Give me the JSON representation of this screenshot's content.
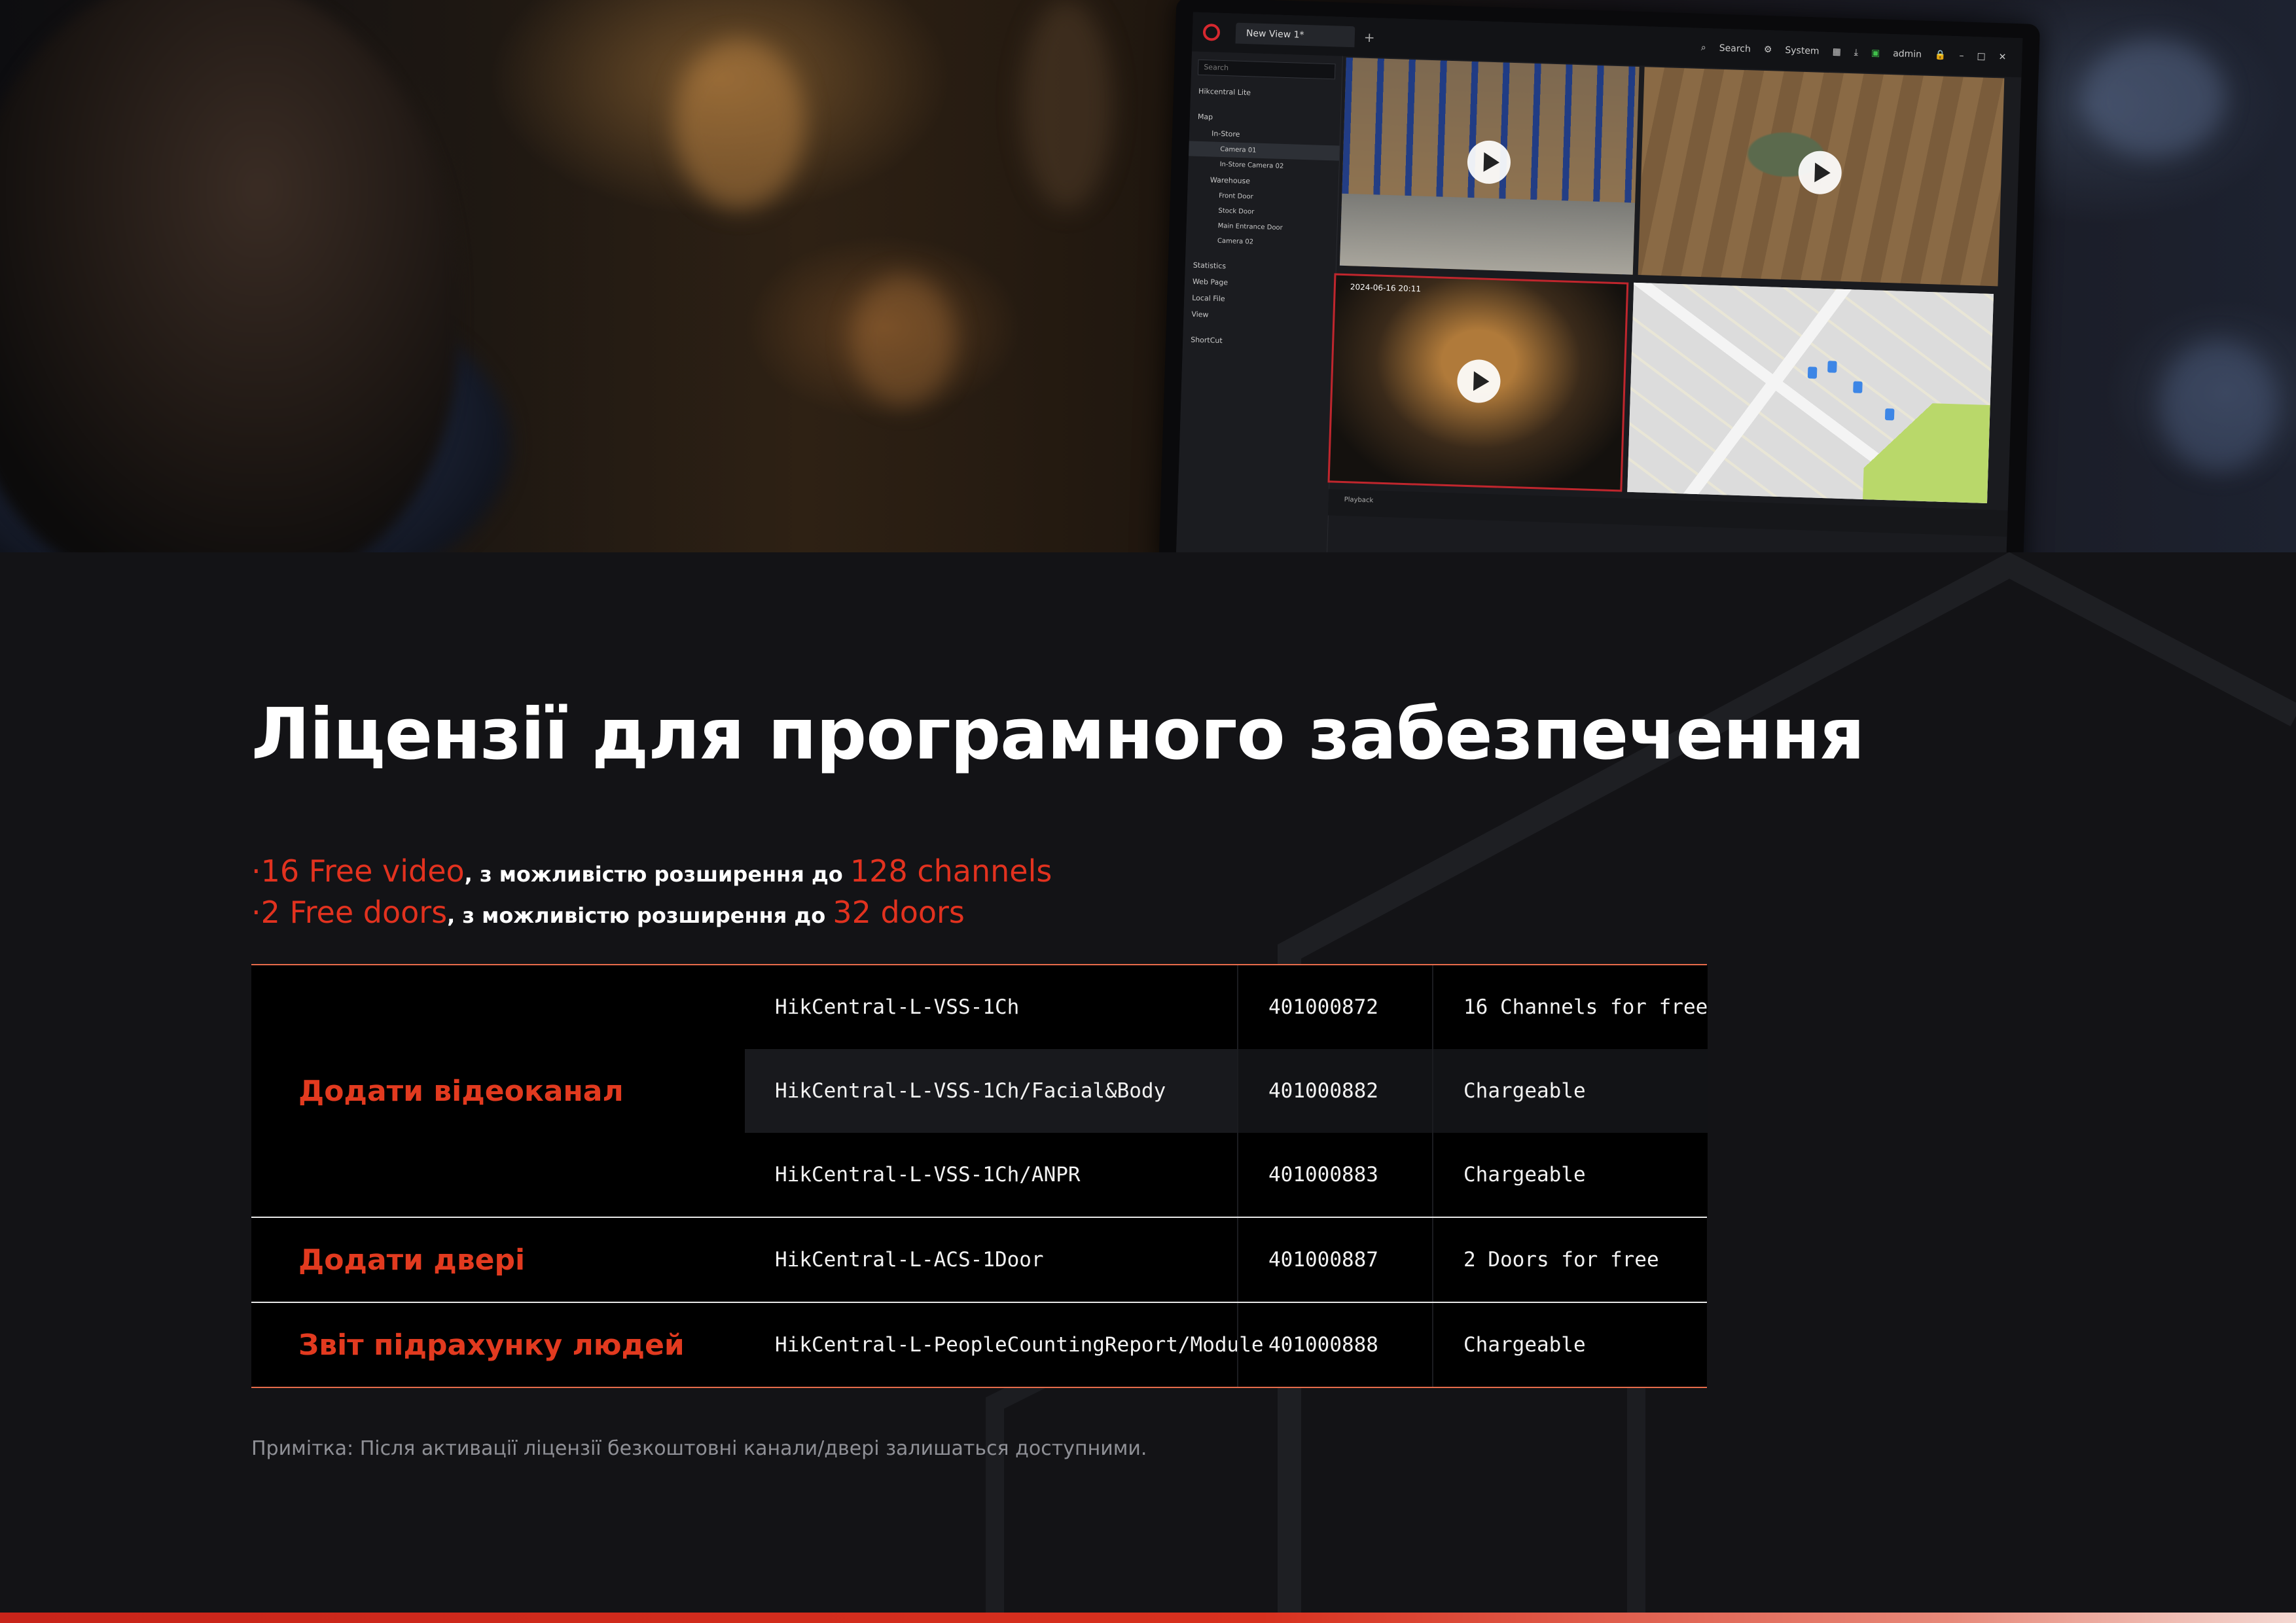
{
  "hero": {
    "app": {
      "tab_label": "New View 1*",
      "toolbar": {
        "search": "Search",
        "system": "System",
        "user": "admin"
      },
      "search_placeholder": "Search",
      "tree": {
        "root": "Hikcentral Lite",
        "map": "Map",
        "in_store": "In-Store",
        "camera_01": "Camera 01",
        "in_store_camera_02": "In-Store Camera 02",
        "warehouse": "Warehouse",
        "front_door": "Front Door",
        "stock_door": "Stock Door",
        "main_entrance_door": "Main Entrance Door",
        "camera_02": "Camera 02",
        "statistics": "Statistics",
        "web_page": "Web Page",
        "local_file": "Local File",
        "view": "View",
        "shortcut": "ShortCut"
      },
      "cam3_timestamp": "2024-06-16 20:11",
      "bottom_tab": "Playback"
    }
  },
  "title": "Ліцензії для програмного забезпечення",
  "features": [
    {
      "bullet": "·",
      "free": "16 Free video",
      "middle": ", з можливістю розширення до ",
      "max": "128 channels"
    },
    {
      "bullet": "·",
      "free": "2 Free doors",
      "middle": ", з можливістю розширення до ",
      "max": "32 doors"
    }
  ],
  "table": {
    "groups": [
      {
        "label": "Додати відеоканал",
        "rows": [
          {
            "name": "HikCentral-L-VSS-1Ch",
            "code": "401000872",
            "note": "16 Channels for free"
          },
          {
            "name": "HikCentral-L-VSS-1Ch/Facial&Body",
            "code": "401000882",
            "note": "Chargeable"
          },
          {
            "name": "HikCentral-L-VSS-1Ch/ANPR",
            "code": "401000883",
            "note": "Chargeable"
          }
        ]
      },
      {
        "label": "Додати двері",
        "rows": [
          {
            "name": "HikCentral-L-ACS-1Door",
            "code": "401000887",
            "note": "2 Doors for free"
          }
        ]
      },
      {
        "label": "Звіт підрахунку людей",
        "rows": [
          {
            "name": "HikCentral-L-PeopleCountingReport/Module",
            "code": "401000888",
            "note": "Chargeable"
          }
        ]
      }
    ]
  },
  "note": "Примітка: Після активації ліцензії безкоштовні канали/двері залишаться доступними.",
  "colors": {
    "accent": "#e2321f",
    "background": "#131316",
    "table_bg": "#000000"
  }
}
